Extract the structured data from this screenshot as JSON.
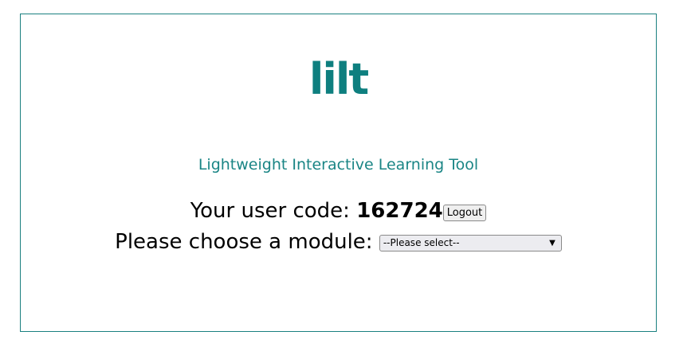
{
  "logo": {
    "text": "lilt",
    "color": "#0e7f7f"
  },
  "tagline": "Lightweight Interactive Learning Tool",
  "user": {
    "label": "Your user code: ",
    "code": "162724",
    "logout_label": "Logout"
  },
  "module": {
    "label": "Please choose a module: ",
    "selected": "--Please select--",
    "chevron_icon": "chevron-down-icon"
  },
  "colors": {
    "accent": "#1a8080"
  }
}
